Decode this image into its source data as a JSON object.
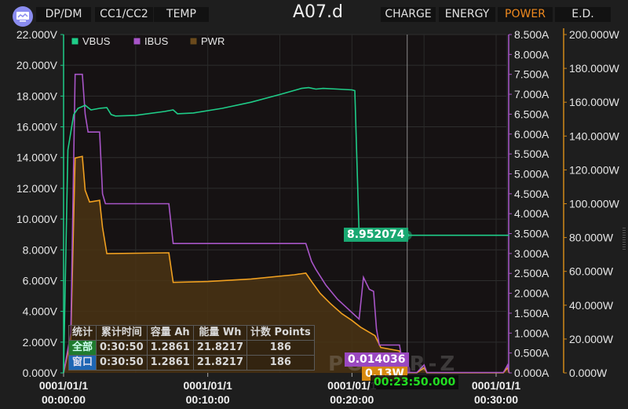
{
  "header": {
    "title": "A07.d",
    "left_tabs": [
      {
        "label": "DP/DM"
      },
      {
        "label": "CC1/CC2"
      },
      {
        "label": "TEMP"
      }
    ],
    "right_tabs": [
      {
        "label": "CHARGE",
        "active": false
      },
      {
        "label": "ENERGY",
        "active": false
      },
      {
        "label": "POWER",
        "active": true
      },
      {
        "label": "E.D.",
        "active": false
      }
    ],
    "logo_icon": "monitor-chart-icon"
  },
  "colors": {
    "vbus": "#1fcc88",
    "ibus": "#a855c8",
    "pwr": "#f0a020",
    "pwr_fill": "#4a3414",
    "accent_tab": "#f08a1e",
    "cursor_time": "#22dd22"
  },
  "stats_table": {
    "headers": [
      "统计",
      "累计时间",
      "容量 Ah",
      "能量 Wh",
      "计数 Points"
    ],
    "rows": [
      {
        "label": "全部",
        "values": [
          "0:30:50",
          "1.2861",
          "21.8217",
          "186"
        ]
      },
      {
        "label": "窗口",
        "values": [
          "0:30:50",
          "1.2861",
          "21.8217",
          "186"
        ]
      }
    ]
  },
  "cursor": {
    "time": "00:23:50.000",
    "vbus_value": "8.952074",
    "ibus_value": "0.014036",
    "pwr_value": "0.13W"
  },
  "watermark": "POWER-Z",
  "chart_data": {
    "type": "line",
    "title": "",
    "x_unit": "minutes",
    "xlim": [
      0,
      30.9
    ],
    "x_ticks": [
      {
        "value": 0,
        "label1": "0001/01/1",
        "label2": "00:00:00"
      },
      {
        "value": 10,
        "label1": "0001/01/1",
        "label2": "00:10:00"
      },
      {
        "value": 20,
        "label1": "0001/01/1",
        "label2": "00:20:00"
      },
      {
        "value": 30,
        "label1": "0001/01/1",
        "label2": "00:30:00"
      }
    ],
    "axes": {
      "voltage": {
        "ylim": [
          0,
          22
        ],
        "ticks": [
          0,
          2,
          4,
          6,
          8,
          10,
          12,
          14,
          16,
          18,
          20,
          22
        ],
        "format": "V",
        "decimals": 3
      },
      "current": {
        "ylim": [
          0,
          8.5
        ],
        "ticks": [
          0,
          0.5,
          1,
          1.5,
          2,
          2.5,
          3,
          3.5,
          4,
          4.5,
          5,
          5.5,
          6,
          6.5,
          7,
          7.5,
          8,
          8.5
        ],
        "format": "A",
        "decimals": 3
      },
      "power": {
        "ylim": [
          0,
          200
        ],
        "ticks": [
          0,
          20,
          40,
          60,
          80,
          100,
          120,
          140,
          160,
          180,
          200
        ],
        "format": "W",
        "decimals": 3
      }
    },
    "legend": [
      "VBUS",
      "IBUS",
      "PWR"
    ],
    "legend_position": "top-left",
    "grid": true,
    "series": [
      {
        "name": "VBUS",
        "axis": "voltage",
        "points": [
          [
            0,
            0
          ],
          [
            0.1,
            5
          ],
          [
            0.3,
            14.5
          ],
          [
            0.7,
            16.8
          ],
          [
            1.0,
            17.2
          ],
          [
            1.5,
            17.4
          ],
          [
            1.9,
            17.1
          ],
          [
            2.5,
            17.2
          ],
          [
            3.0,
            17.25
          ],
          [
            3.3,
            16.8
          ],
          [
            3.6,
            16.7
          ],
          [
            5,
            16.75
          ],
          [
            7,
            17.0
          ],
          [
            7.6,
            17.1
          ],
          [
            7.9,
            16.85
          ],
          [
            9,
            16.9
          ],
          [
            11,
            17.2
          ],
          [
            13,
            17.6
          ],
          [
            15,
            18.1
          ],
          [
            16.5,
            18.5
          ],
          [
            17,
            18.55
          ],
          [
            17.5,
            18.45
          ],
          [
            18,
            18.5
          ],
          [
            19,
            18.45
          ],
          [
            20,
            18.4
          ],
          [
            20.2,
            18.35
          ],
          [
            20.5,
            8.95
          ],
          [
            23.83,
            8.95
          ],
          [
            30.9,
            8.95
          ]
        ]
      },
      {
        "name": "IBUS",
        "axis": "current",
        "points": [
          [
            0,
            0
          ],
          [
            0.5,
            1.0
          ],
          [
            0.8,
            7.5
          ],
          [
            1.3,
            7.5
          ],
          [
            1.5,
            6.5
          ],
          [
            1.7,
            6.05
          ],
          [
            2.5,
            6.05
          ],
          [
            2.7,
            4.5
          ],
          [
            2.9,
            4.25
          ],
          [
            7.3,
            4.25
          ],
          [
            7.6,
            3.25
          ],
          [
            16.8,
            3.25
          ],
          [
            17.2,
            2.8
          ],
          [
            17.5,
            2.6
          ],
          [
            18.2,
            2.2
          ],
          [
            19,
            1.85
          ],
          [
            19.6,
            1.65
          ],
          [
            20.2,
            1.45
          ],
          [
            20.5,
            1.35
          ],
          [
            20.8,
            2.4
          ],
          [
            21.2,
            2.1
          ],
          [
            21.5,
            2.05
          ],
          [
            21.7,
            1.1
          ],
          [
            21.9,
            0.7
          ],
          [
            23.3,
            0.7
          ],
          [
            23.6,
            0.05
          ],
          [
            23.83,
            0.014
          ],
          [
            24.5,
            0.01
          ],
          [
            25,
            0.2
          ],
          [
            25.2,
            0.01
          ],
          [
            30.5,
            0.01
          ],
          [
            30.8,
            0.2
          ],
          [
            30.9,
            0.01
          ]
        ]
      },
      {
        "name": "PWR",
        "axis": "power",
        "points": [
          [
            0,
            0
          ],
          [
            0.5,
            20
          ],
          [
            0.8,
            127
          ],
          [
            1.3,
            128
          ],
          [
            1.5,
            108
          ],
          [
            1.8,
            101
          ],
          [
            2.5,
            102
          ],
          [
            2.7,
            86
          ],
          [
            3.0,
            70.5
          ],
          [
            7.3,
            71
          ],
          [
            7.6,
            53.5
          ],
          [
            10,
            54
          ],
          [
            13,
            55.5
          ],
          [
            16,
            58
          ],
          [
            16.8,
            59
          ],
          [
            17.2,
            54
          ],
          [
            17.8,
            47
          ],
          [
            18.5,
            41
          ],
          [
            19.3,
            35
          ],
          [
            20,
            31
          ],
          [
            20.6,
            27
          ],
          [
            21.6,
            22
          ],
          [
            22,
            15
          ],
          [
            23.3,
            13
          ],
          [
            23.6,
            1
          ],
          [
            23.83,
            0.13
          ],
          [
            24.5,
            0.1
          ],
          [
            25,
            3
          ],
          [
            25.2,
            0.1
          ],
          [
            30.5,
            0.1
          ],
          [
            30.8,
            3
          ],
          [
            30.9,
            0.1
          ]
        ]
      }
    ]
  }
}
